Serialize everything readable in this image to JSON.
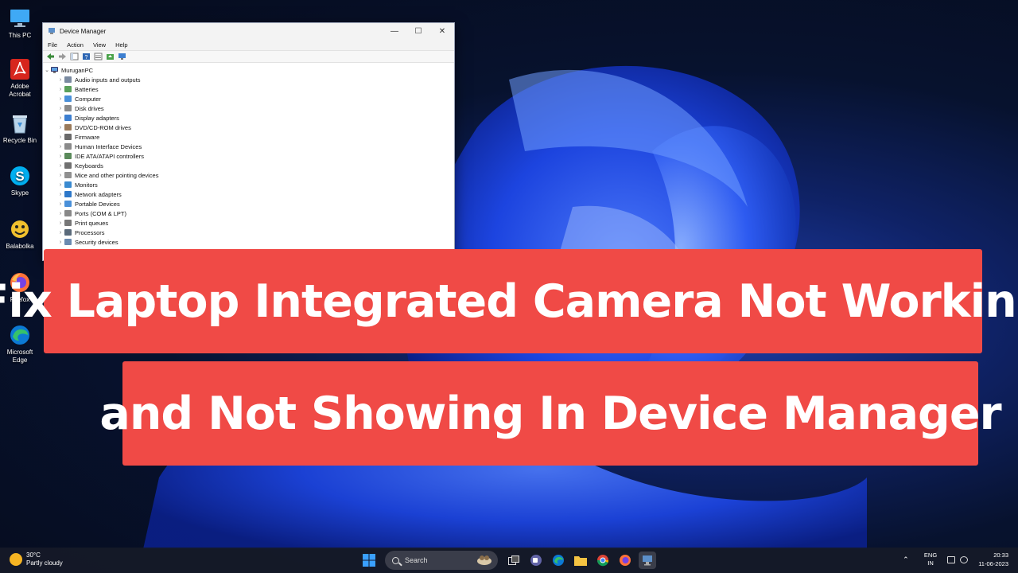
{
  "desktop": {
    "icons": [
      {
        "label": "This PC",
        "icon": "monitor-icon"
      },
      {
        "label": "Adobe Acrobat",
        "icon": "acrobat-icon"
      },
      {
        "label": "Recycle Bin",
        "icon": "recycle-bin-icon"
      },
      {
        "label": "Skype",
        "icon": "skype-icon"
      },
      {
        "label": "Balabolka",
        "icon": "balabolka-icon"
      },
      {
        "label": "Firefox",
        "icon": "firefox-icon"
      },
      {
        "label": "Microsoft Edge",
        "icon": "edge-icon"
      }
    ]
  },
  "window": {
    "title": "Device Manager",
    "minimize": "—",
    "maximize": "☐",
    "close": "✕",
    "menu": [
      "File",
      "Action",
      "View",
      "Help"
    ],
    "root": "MuruganPC",
    "categories": [
      "Audio inputs and outputs",
      "Batteries",
      "Computer",
      "Disk drives",
      "Display adapters",
      "DVD/CD-ROM drives",
      "Firmware",
      "Human Interface Devices",
      "IDE ATA/ATAPI controllers",
      "Keyboards",
      "Mice and other pointing devices",
      "Monitors",
      "Network adapters",
      "Portable Devices",
      "Ports (COM & LPT)",
      "Print queues",
      "Processors",
      "Security devices"
    ]
  },
  "banner": {
    "line1": "Fix Laptop Integrated Camera Not Working",
    "line2": "and Not Showing In Device Manager"
  },
  "taskbar": {
    "weather_temp": "30°C",
    "weather_desc": "Partly cloudy",
    "search_label": "Search",
    "lang_top": "ENG",
    "lang_bottom": "IN",
    "time": "20:33",
    "date": "11-06-2023"
  },
  "colors": {
    "banner": "#f04a46",
    "accent": "#0067c0"
  }
}
